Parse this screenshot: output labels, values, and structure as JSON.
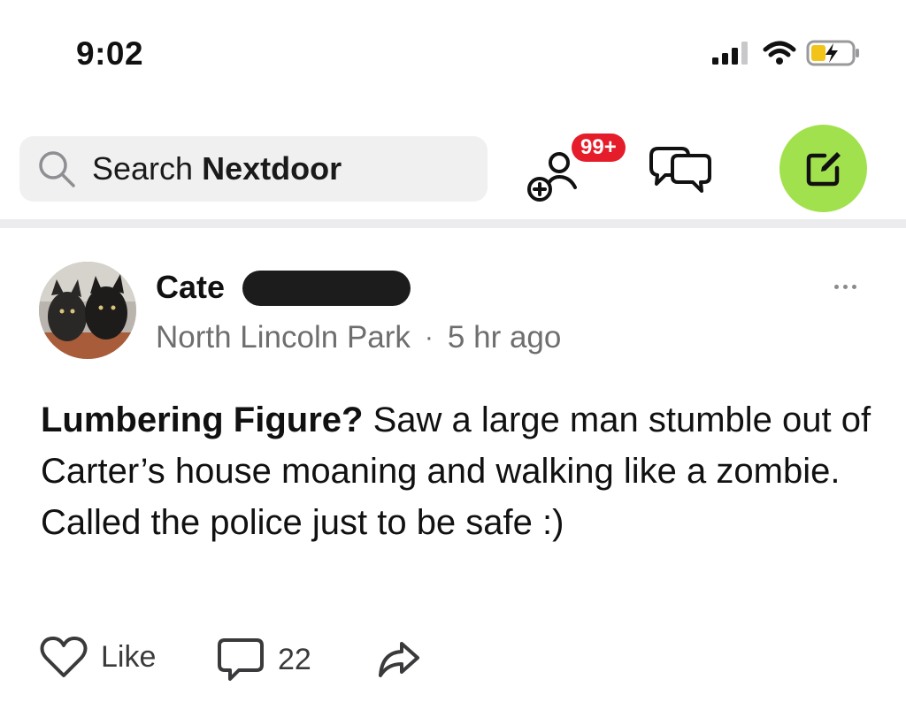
{
  "status_bar": {
    "time": "9:02",
    "icons": [
      "cellular-signal-icon",
      "wifi-icon",
      "battery-charging-icon"
    ]
  },
  "header": {
    "search": {
      "label_prefix": "Search ",
      "label_brand": "Nextdoor"
    },
    "friends_badge": "99+",
    "icons": [
      "search-icon",
      "add-friends-icon",
      "chat-icon",
      "compose-icon"
    ],
    "accent_color": "#a2e14e",
    "badge_color": "#e51d2b"
  },
  "post": {
    "author_first_name": "Cate",
    "author_last_name_redacted": true,
    "neighborhood": "North Lincoln Park",
    "separator": "·",
    "time_ago": "5 hr ago",
    "title": "Lumbering Figure?",
    "body": "Saw a large man stumble out of Carter’s house moaning and walking like a zombie. Called the police just to be safe :)",
    "actions": {
      "like_label": "Like",
      "comment_count": "22"
    }
  }
}
